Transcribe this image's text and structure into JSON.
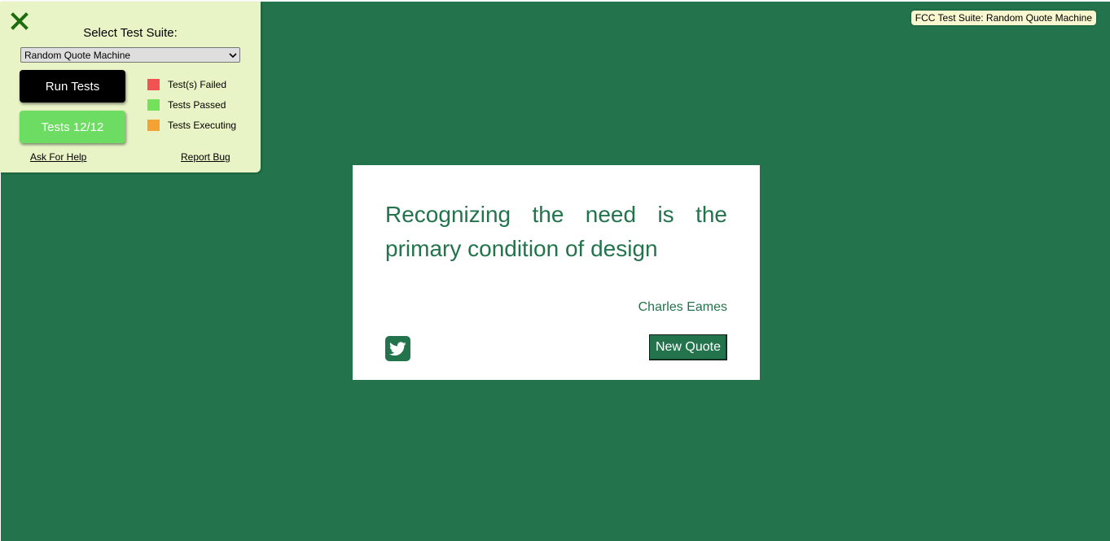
{
  "colors": {
    "background": "#23744c",
    "panel": "#e8f4c6",
    "failed": "#f25252",
    "passed": "#74e15b",
    "executing": "#f4a234",
    "tests_button": "#6ddc62",
    "close_icon": "#1d6b0f"
  },
  "test_panel": {
    "close_icon": "close-icon",
    "title": "Select Test Suite:",
    "selected_suite": "Random Quote Machine",
    "run_button": "Run Tests",
    "tests_button": "Tests 12/12",
    "legend": {
      "failed": "Test(s) Failed",
      "passed": "Tests Passed",
      "executing": "Tests Executing"
    },
    "help_link": "Ask For Help",
    "bug_link": "Report Bug"
  },
  "suite_badge": "FCC Test Suite: Random Quote Machine",
  "quote": {
    "text": "Recognizing the need is the primary condition of design",
    "author": "Charles Eames",
    "tweet_icon": "twitter-icon",
    "new_quote_button": "New Quote"
  }
}
